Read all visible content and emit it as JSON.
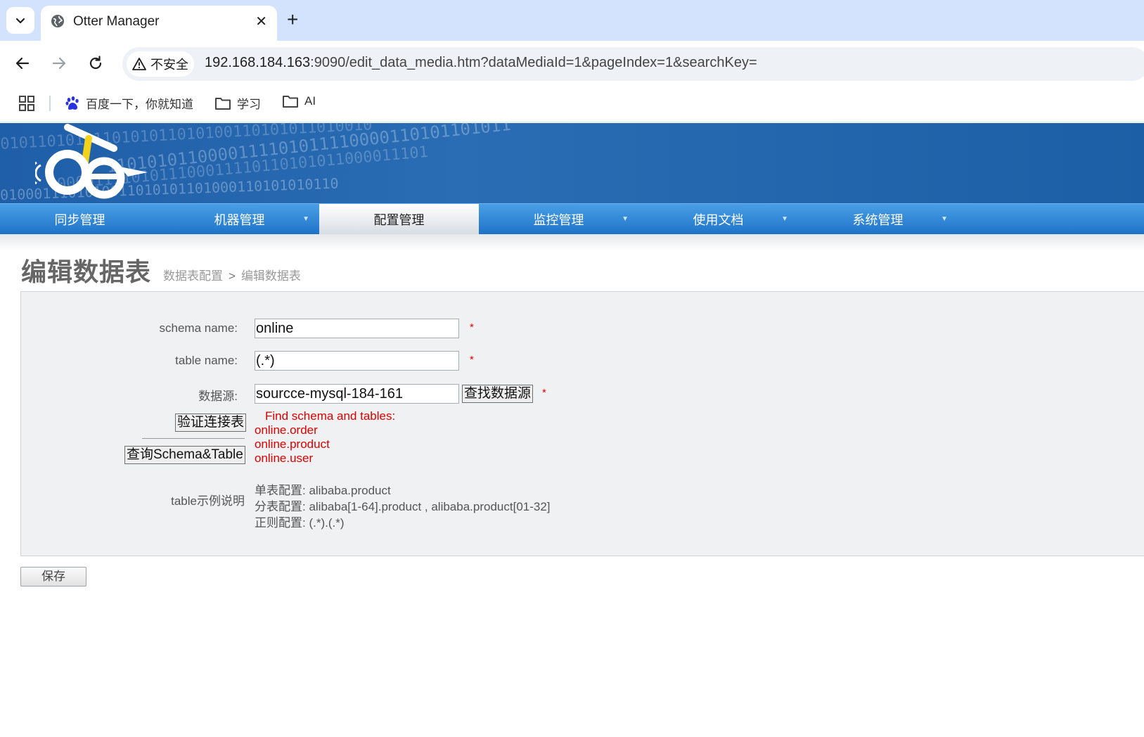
{
  "browser": {
    "tab_title": "Otter Manager",
    "insecure_label": "不安全",
    "url_host": "192.168.184.163",
    "url_rest": ":9090/edit_data_media.htm?dataMediaId=1&pageIndex=1&searchKey=",
    "bookmarks": [
      {
        "label": "百度一下，你就知道",
        "icon": "baidu-paw-icon"
      },
      {
        "label": "学习",
        "icon": "folder-icon"
      },
      {
        "label": "AI",
        "icon": "folder-icon"
      }
    ]
  },
  "header": {
    "binary_rows": [
      "0101101010110101011010100110101011010010",
      "1101010110000111101011110000110101101011",
      "0000111101011100011110110101011000011101",
      "0100011101010011010101101000110101010110"
    ]
  },
  "nav": {
    "items": [
      {
        "label": "同步管理",
        "dropdown": false,
        "active": false
      },
      {
        "label": "机器管理",
        "dropdown": true,
        "active": false
      },
      {
        "label": "配置管理",
        "dropdown": false,
        "active": true
      },
      {
        "label": "监控管理",
        "dropdown": true,
        "active": false
      },
      {
        "label": "使用文档",
        "dropdown": true,
        "active": false
      },
      {
        "label": "系统管理",
        "dropdown": true,
        "active": false
      }
    ]
  },
  "page": {
    "title": "编辑数据表",
    "breadcrumb": [
      "数据表配置",
      "编辑数据表"
    ],
    "breadcrumb_sep": ">"
  },
  "form": {
    "schema_label": "schema name:",
    "schema_value": "online",
    "table_label": "table name:",
    "table_value": "(.*)",
    "datasource_label": "数据源:",
    "datasource_value": "sourcce-mysql-184-161",
    "find_datasource_btn": "查找数据源",
    "required_mark": "*",
    "verify_btn": "验证连接表",
    "query_btn": "查询Schema&Table",
    "result_header": "Find schema and tables:",
    "result_items": [
      "online.order",
      "online.product",
      "online.user"
    ],
    "example_label": "table示例说明",
    "examples": [
      "单表配置: alibaba.product",
      "分表配置: alibaba[1-64].product , alibaba.product[01-32]",
      "正则配置: (.*).(.*)"
    ],
    "save_btn": "保存"
  },
  "colors": {
    "nav_blue": "#1e73c8",
    "banner_blue": "#1f5ea8",
    "required_red": "#e00000"
  }
}
